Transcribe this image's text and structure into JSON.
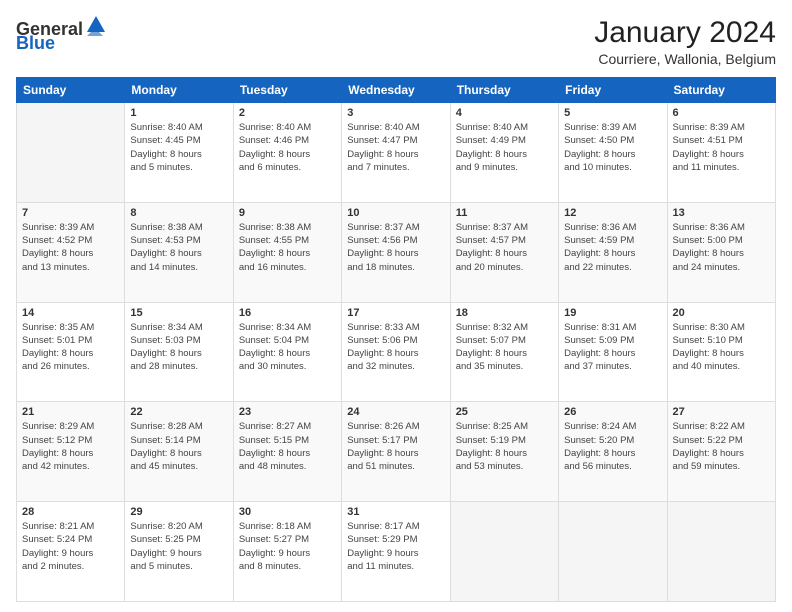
{
  "header": {
    "logo": {
      "general": "General",
      "blue": "Blue"
    },
    "title": "January 2024",
    "subtitle": "Courriere, Wallonia, Belgium"
  },
  "calendar": {
    "days": [
      "Sunday",
      "Monday",
      "Tuesday",
      "Wednesday",
      "Thursday",
      "Friday",
      "Saturday"
    ],
    "weeks": [
      [
        {
          "day": "",
          "info": ""
        },
        {
          "day": "1",
          "info": "Sunrise: 8:40 AM\nSunset: 4:45 PM\nDaylight: 8 hours\nand 5 minutes."
        },
        {
          "day": "2",
          "info": "Sunrise: 8:40 AM\nSunset: 4:46 PM\nDaylight: 8 hours\nand 6 minutes."
        },
        {
          "day": "3",
          "info": "Sunrise: 8:40 AM\nSunset: 4:47 PM\nDaylight: 8 hours\nand 7 minutes."
        },
        {
          "day": "4",
          "info": "Sunrise: 8:40 AM\nSunset: 4:49 PM\nDaylight: 8 hours\nand 9 minutes."
        },
        {
          "day": "5",
          "info": "Sunrise: 8:39 AM\nSunset: 4:50 PM\nDaylight: 8 hours\nand 10 minutes."
        },
        {
          "day": "6",
          "info": "Sunrise: 8:39 AM\nSunset: 4:51 PM\nDaylight: 8 hours\nand 11 minutes."
        }
      ],
      [
        {
          "day": "7",
          "info": "Sunrise: 8:39 AM\nSunset: 4:52 PM\nDaylight: 8 hours\nand 13 minutes."
        },
        {
          "day": "8",
          "info": "Sunrise: 8:38 AM\nSunset: 4:53 PM\nDaylight: 8 hours\nand 14 minutes."
        },
        {
          "day": "9",
          "info": "Sunrise: 8:38 AM\nSunset: 4:55 PM\nDaylight: 8 hours\nand 16 minutes."
        },
        {
          "day": "10",
          "info": "Sunrise: 8:37 AM\nSunset: 4:56 PM\nDaylight: 8 hours\nand 18 minutes."
        },
        {
          "day": "11",
          "info": "Sunrise: 8:37 AM\nSunset: 4:57 PM\nDaylight: 8 hours\nand 20 minutes."
        },
        {
          "day": "12",
          "info": "Sunrise: 8:36 AM\nSunset: 4:59 PM\nDaylight: 8 hours\nand 22 minutes."
        },
        {
          "day": "13",
          "info": "Sunrise: 8:36 AM\nSunset: 5:00 PM\nDaylight: 8 hours\nand 24 minutes."
        }
      ],
      [
        {
          "day": "14",
          "info": "Sunrise: 8:35 AM\nSunset: 5:01 PM\nDaylight: 8 hours\nand 26 minutes."
        },
        {
          "day": "15",
          "info": "Sunrise: 8:34 AM\nSunset: 5:03 PM\nDaylight: 8 hours\nand 28 minutes."
        },
        {
          "day": "16",
          "info": "Sunrise: 8:34 AM\nSunset: 5:04 PM\nDaylight: 8 hours\nand 30 minutes."
        },
        {
          "day": "17",
          "info": "Sunrise: 8:33 AM\nSunset: 5:06 PM\nDaylight: 8 hours\nand 32 minutes."
        },
        {
          "day": "18",
          "info": "Sunrise: 8:32 AM\nSunset: 5:07 PM\nDaylight: 8 hours\nand 35 minutes."
        },
        {
          "day": "19",
          "info": "Sunrise: 8:31 AM\nSunset: 5:09 PM\nDaylight: 8 hours\nand 37 minutes."
        },
        {
          "day": "20",
          "info": "Sunrise: 8:30 AM\nSunset: 5:10 PM\nDaylight: 8 hours\nand 40 minutes."
        }
      ],
      [
        {
          "day": "21",
          "info": "Sunrise: 8:29 AM\nSunset: 5:12 PM\nDaylight: 8 hours\nand 42 minutes."
        },
        {
          "day": "22",
          "info": "Sunrise: 8:28 AM\nSunset: 5:14 PM\nDaylight: 8 hours\nand 45 minutes."
        },
        {
          "day": "23",
          "info": "Sunrise: 8:27 AM\nSunset: 5:15 PM\nDaylight: 8 hours\nand 48 minutes."
        },
        {
          "day": "24",
          "info": "Sunrise: 8:26 AM\nSunset: 5:17 PM\nDaylight: 8 hours\nand 51 minutes."
        },
        {
          "day": "25",
          "info": "Sunrise: 8:25 AM\nSunset: 5:19 PM\nDaylight: 8 hours\nand 53 minutes."
        },
        {
          "day": "26",
          "info": "Sunrise: 8:24 AM\nSunset: 5:20 PM\nDaylight: 8 hours\nand 56 minutes."
        },
        {
          "day": "27",
          "info": "Sunrise: 8:22 AM\nSunset: 5:22 PM\nDaylight: 8 hours\nand 59 minutes."
        }
      ],
      [
        {
          "day": "28",
          "info": "Sunrise: 8:21 AM\nSunset: 5:24 PM\nDaylight: 9 hours\nand 2 minutes."
        },
        {
          "day": "29",
          "info": "Sunrise: 8:20 AM\nSunset: 5:25 PM\nDaylight: 9 hours\nand 5 minutes."
        },
        {
          "day": "30",
          "info": "Sunrise: 8:18 AM\nSunset: 5:27 PM\nDaylight: 9 hours\nand 8 minutes."
        },
        {
          "day": "31",
          "info": "Sunrise: 8:17 AM\nSunset: 5:29 PM\nDaylight: 9 hours\nand 11 minutes."
        },
        {
          "day": "",
          "info": ""
        },
        {
          "day": "",
          "info": ""
        },
        {
          "day": "",
          "info": ""
        }
      ]
    ]
  }
}
